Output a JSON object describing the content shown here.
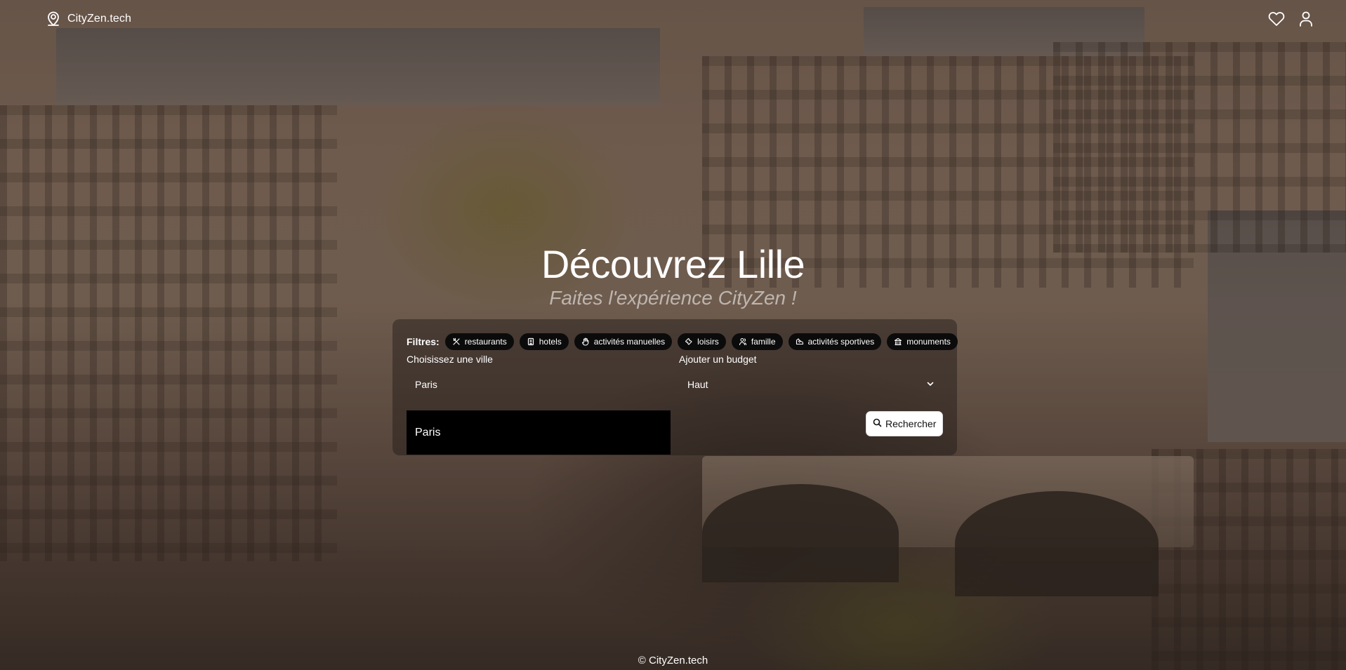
{
  "header": {
    "brand": "CityZen.tech",
    "brand_icon": "map-pin-icon",
    "favorites_icon": "heart-icon",
    "account_icon": "user-icon"
  },
  "hero": {
    "title": "Découvrez Lille",
    "subtitle": "Faites l'expérience CityZen !"
  },
  "filters": {
    "label": "Filtres:",
    "chips": [
      {
        "label": "restaurants",
        "icon": "utensils-icon"
      },
      {
        "label": "hotels",
        "icon": "hotel-icon"
      },
      {
        "label": "activités manuelles",
        "icon": "hand-icon"
      },
      {
        "label": "loisirs",
        "icon": "ticket-icon"
      },
      {
        "label": "famille",
        "icon": "family-icon"
      },
      {
        "label": "activités sportives",
        "icon": "sport-shoe-icon"
      },
      {
        "label": "monuments",
        "icon": "landmark-icon"
      }
    ]
  },
  "search": {
    "city_label": "Choisissez une ville",
    "city_value": "Paris",
    "budget_label": "Ajouter un budget",
    "budget_value": "Haut",
    "dropdown_option": "Paris",
    "button_label": "Rechercher"
  },
  "footer": {
    "text": "© CityZen.tech"
  }
}
